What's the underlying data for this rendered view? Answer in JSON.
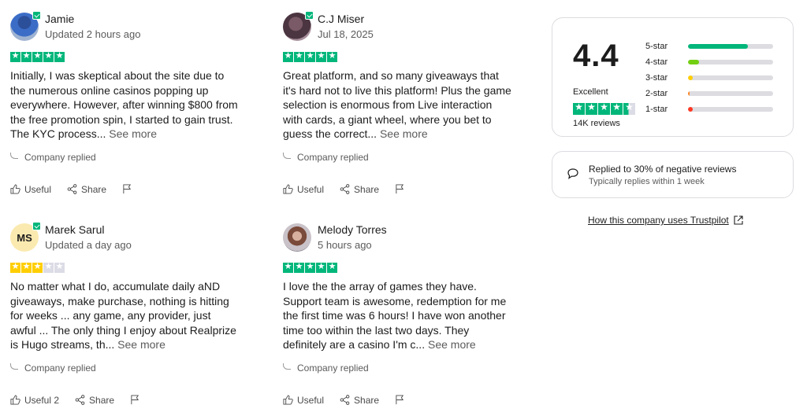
{
  "reviews": [
    {
      "name": "Jamie",
      "date": "Updated 2 hours ago",
      "rating": 5,
      "text": "Initially, I was skeptical about the site due to the numerous online casinos popping up everywhere. However, after winning $800 from the free promotion spin, I started to gain trust. The KYC process...",
      "more": "See more",
      "replied": "Company replied",
      "useful": "Useful",
      "share": "Share"
    },
    {
      "name": "C.J Miser",
      "date": "Jul 18, 2025",
      "rating": 5,
      "text": "Great platform, and so many giveaways that it's hard not to live this platform! Plus the game selection is enormous from Live interaction with cards, a giant wheel, where you bet to guess the correct...",
      "more": "See more",
      "replied": "Company replied",
      "useful": "Useful",
      "share": "Share"
    },
    {
      "name": "Marek Sarul",
      "initials": "MS",
      "date": "Updated a day ago",
      "rating": 3,
      "text": "No matter what I do, accumulate daily aND giveaways, make purchase, nothing is hitting for weeks ... any game, any provider, just awful ... The only thing I enjoy about Realprize is Hugo streams, th...",
      "more": "See more",
      "replied": "Company replied",
      "useful": "Useful 2",
      "share": "Share"
    },
    {
      "name": "Melody Torres",
      "date": "5 hours ago",
      "rating": 5,
      "text": "I love the the array of games they have. Support team is awesome, redemption for me the first time was 6 hours! I have won another time too within the last two days. They definitely are a casino I'm c...",
      "more": "See more",
      "replied": "Company replied",
      "useful": "Useful",
      "share": "Share"
    }
  ],
  "summary": {
    "score": "4.4",
    "label": "Excellent",
    "reviews_count": "14K reviews",
    "distribution": [
      {
        "label": "5-star",
        "fraction": 0.7,
        "color": "#00b67a"
      },
      {
        "label": "4-star",
        "fraction": 0.13,
        "color": "#73cf11"
      },
      {
        "label": "3-star",
        "fraction": 0.06,
        "color": "#ffce00"
      },
      {
        "label": "2-star",
        "fraction": 0.02,
        "color": "#ff8622"
      },
      {
        "label": "1-star",
        "fraction": 0.06,
        "color": "#ff3722"
      }
    ]
  },
  "reply_info": {
    "line1": "Replied to 30% of negative reviews",
    "line2": "Typically replies within 1 week"
  },
  "how_link": "How this company uses Trustpilot",
  "icons": [
    "verified-badge-icon",
    "thumbs-up-icon",
    "share-icon",
    "flag-icon",
    "chat-bubble-icon",
    "external-link-icon"
  ]
}
